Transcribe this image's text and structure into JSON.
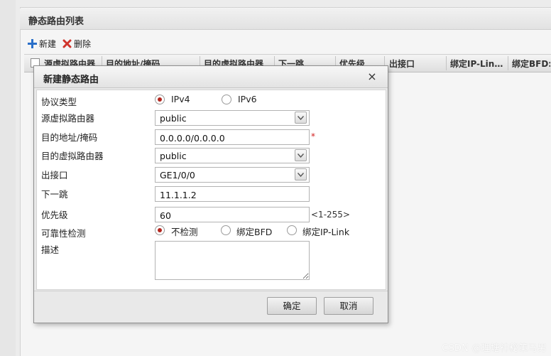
{
  "panel": {
    "title": "静态路由列表",
    "toolbar": {
      "new_label": "新建",
      "delete_label": "删除"
    },
    "columns": [
      "源虚拟路由器",
      "目的地址/掩码",
      "目的虚拟路由器",
      "下一跳",
      "优先级",
      "出接口",
      "绑定IP-Lin…",
      "绑定BFD:"
    ]
  },
  "dialog": {
    "title": "新建静态路由",
    "close_glyph": "×",
    "protocol": {
      "label": "协议类型",
      "options": [
        "IPv4",
        "IPv6"
      ],
      "selected": "IPv4"
    },
    "src_vrouter": {
      "label": "源虚拟路由器",
      "value": "public"
    },
    "dest": {
      "label": "目的地址/掩码",
      "value": "0.0.0.0/0.0.0.0",
      "required_mark": "*"
    },
    "dest_vrouter": {
      "label": "目的虚拟路由器",
      "value": "public"
    },
    "out_iface": {
      "label": "出接口",
      "value": "GE1/0/0"
    },
    "next_hop": {
      "label": "下一跳",
      "value": "11.1.1.2"
    },
    "priority": {
      "label": "优先级",
      "value": "60",
      "hint": "<1-255>"
    },
    "reliability": {
      "label": "可靠性检测",
      "options": [
        "不检测",
        "绑定BFD",
        "绑定IP-Link"
      ],
      "selected": "不检测"
    },
    "description": {
      "label": "描述",
      "value": ""
    },
    "buttons": {
      "ok": "确定",
      "cancel": "取消"
    }
  },
  "watermark": "CSDN @理塘神秘策马男",
  "colors": {
    "accent_radio": "#b3261e",
    "required": "#d21f1f",
    "add_icon": "#2a6fc9",
    "delete_icon": "#d0342c"
  }
}
